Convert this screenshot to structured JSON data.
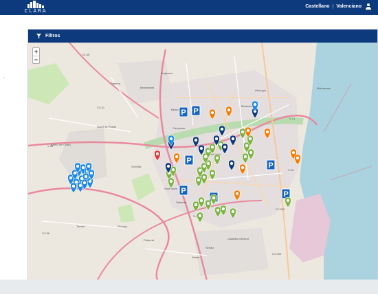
{
  "header": {
    "logo_text": "CLARA",
    "language_options": [
      "Castellano",
      "Valenciano"
    ],
    "separator": "|",
    "colors": {
      "bar": "#0d3a7d"
    }
  },
  "panel": {
    "title": "Filtros",
    "zoom": {
      "in": "+",
      "out": "−"
    }
  },
  "map": {
    "colors": {
      "blue_marker": "#1e88e5",
      "navy_marker": "#0d3a7d",
      "green_marker": "#7cb342",
      "orange_marker": "#f57c00",
      "red_marker": "#e53935",
      "parking_sign": "#1565c0"
    },
    "place_labels": [
      "Paterna",
      "Benimàmet",
      "Burjassot",
      "Quart de Poblet",
      "Barrio del Cristo",
      "Aldaia",
      "Xirivella",
      "Torrent",
      "Picanya",
      "Paiporta",
      "Sedaví",
      "Alfafar",
      "Castellar-Oliveral",
      "Campanar",
      "Benicalap",
      "Benimaclet",
      "Alboraya",
      "Malvarrosa",
      "Ciutat Vella",
      "Safranar",
      "Sant Isidre"
    ],
    "road_labels": [
      "CV-35",
      "V-30",
      "CV-31",
      "CV-36",
      "CV-400",
      "V-31",
      "CV-500",
      "V-21",
      "V-15"
    ]
  }
}
